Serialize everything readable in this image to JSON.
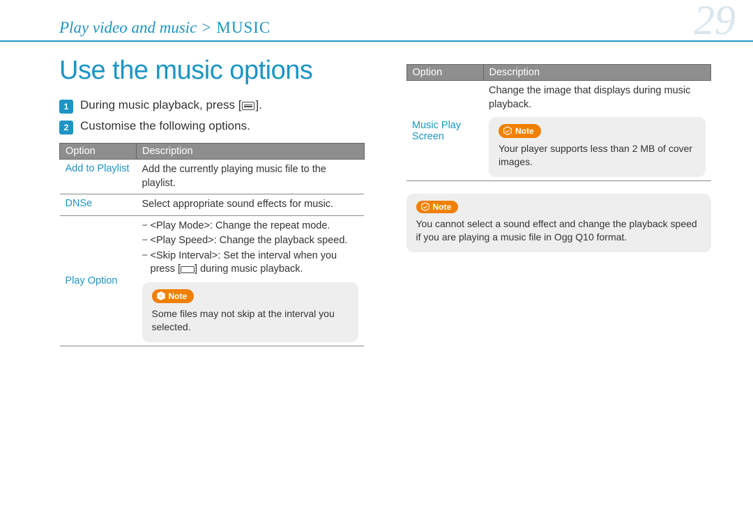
{
  "header": {
    "breadcrumb_part1": "Play video and music >",
    "breadcrumb_part2": " MUSIC",
    "page_number": "29"
  },
  "title": "Use the music options",
  "steps": {
    "s1_pre": "During music playback, press [",
    "s1_post": "].",
    "s2": "Customise the following options."
  },
  "table_headers": {
    "option": "Option",
    "description": "Description"
  },
  "left_table": {
    "r1_opt": "Add to Playlist",
    "r1_desc": "Add the currently playing music file to the playlist.",
    "r2_opt": "DNSe",
    "r2_desc": "Select appropriate sound effects for music.",
    "r3_opt": "Play Option",
    "r3_sub1": "<Play Mode>: Change the repeat mode.",
    "r3_sub2": "<Play Speed>: Change the playback speed.",
    "r3_sub3_pre": "<Skip Interval>: Set the interval when you press [",
    "r3_sub3_post": "] during music playback.",
    "r3_note": "Some files may not skip at the interval you selected."
  },
  "right_table": {
    "r1_opt": "Music Play Screen",
    "r1_desc": "Change the image that displays during music playback.",
    "r1_note": "Your player supports less than 2 MB of cover images."
  },
  "bottom_note": "You cannot select a sound effect and change the playback speed if you are playing a music file in Ogg Q10 format.",
  "note_label": "Note"
}
